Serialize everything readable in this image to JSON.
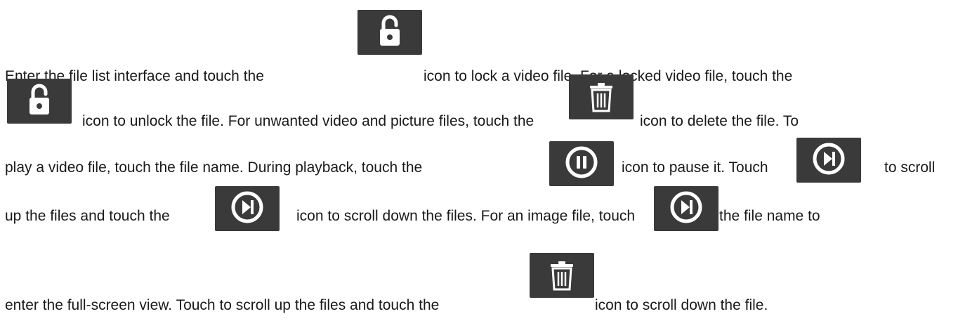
{
  "doc": {
    "colors": {
      "text": "#1a1a1a",
      "icon_background": "#3a3a3a",
      "icon_glyph": "#ffffff"
    },
    "lines": [
      {
        "segments": [
          "Enter the file list interface and touch the",
          "icon to lock a video file. For a locked video file, touch the"
        ]
      },
      {
        "segments": [
          "icon to unlock the file. For unwanted video and picture files, touch the",
          "icon to delete the file. To"
        ]
      },
      {
        "segments": [
          "play a video file, touch the file name. During playback, touch the",
          "icon to pause it. Touch",
          "to scroll"
        ]
      },
      {
        "segments": [
          "up the files and touch the",
          "icon to scroll down the files. For an image file, touch",
          "the file name to"
        ]
      },
      {
        "segments": [
          "enter the full-screen view. Touch to scroll up the files and touch the",
          "icon to scroll down the file."
        ]
      }
    ],
    "icons": [
      "unlock-icon",
      "unlock-icon",
      "trash-icon",
      "pause-icon",
      "skip-next-icon",
      "skip-next-icon",
      "skip-next-icon",
      "trash-icon"
    ]
  }
}
